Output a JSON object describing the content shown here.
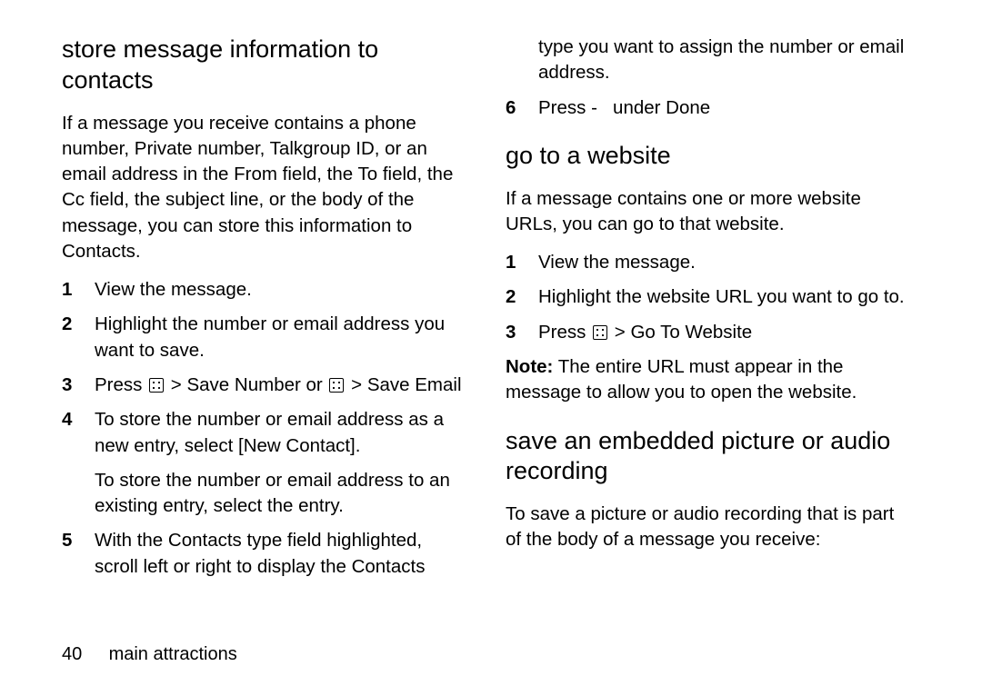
{
  "left": {
    "heading": "store message information to contacts",
    "intro": "If a message you receive contains a phone number, Private number, Talkgroup ID, or an email address in the From field, the To field, the Cc field, the subject line, or the body of the message, you can store this information to Contacts.",
    "steps": {
      "s1": {
        "num": "1",
        "text": "View the message."
      },
      "s2": {
        "num": "2",
        "text": "Highlight the number or email address you want to save."
      },
      "s3": {
        "num": "3",
        "press": "Press ",
        "sep1": " > ",
        "opt1": "Save Number",
        "or": " or ",
        "sep2": " > ",
        "opt2": "Save Email"
      },
      "s4": {
        "num": "4",
        "text_a": "To store the number or email address as a new entry, select ",
        "bold": "[New Contact]",
        "text_b": ".",
        "sub": "To store the number or email address to an existing entry, select the entry."
      },
      "s5": {
        "num": "5",
        "text": "With the Contacts type field highlighted, scroll left or right to display the Contacts"
      }
    }
  },
  "right": {
    "cont5": "type you want to assign the number or email address.",
    "s6": {
      "num": "6",
      "press": "Press ",
      "dash": "-",
      "under": " under ",
      "done": "Done"
    },
    "section_goto": {
      "heading": "go to a website",
      "intro": "If a message contains one or more website URLs, you can go to that website.",
      "s1": {
        "num": "1",
        "text": "View the message."
      },
      "s2": {
        "num": "2",
        "text": "Highlight the website URL you want to go to."
      },
      "s3": {
        "num": "3",
        "press": "Press ",
        "sep": " > ",
        "opt": "Go To Website"
      },
      "note_label": "Note:",
      "note_text": " The entire URL must appear in the message to allow you to open the website."
    },
    "section_save": {
      "heading": "save an embedded picture or audio recording",
      "intro": "To save a picture or audio recording that is part of the body of a message you receive:"
    }
  },
  "footer": {
    "page": "40",
    "section": "main attractions"
  }
}
